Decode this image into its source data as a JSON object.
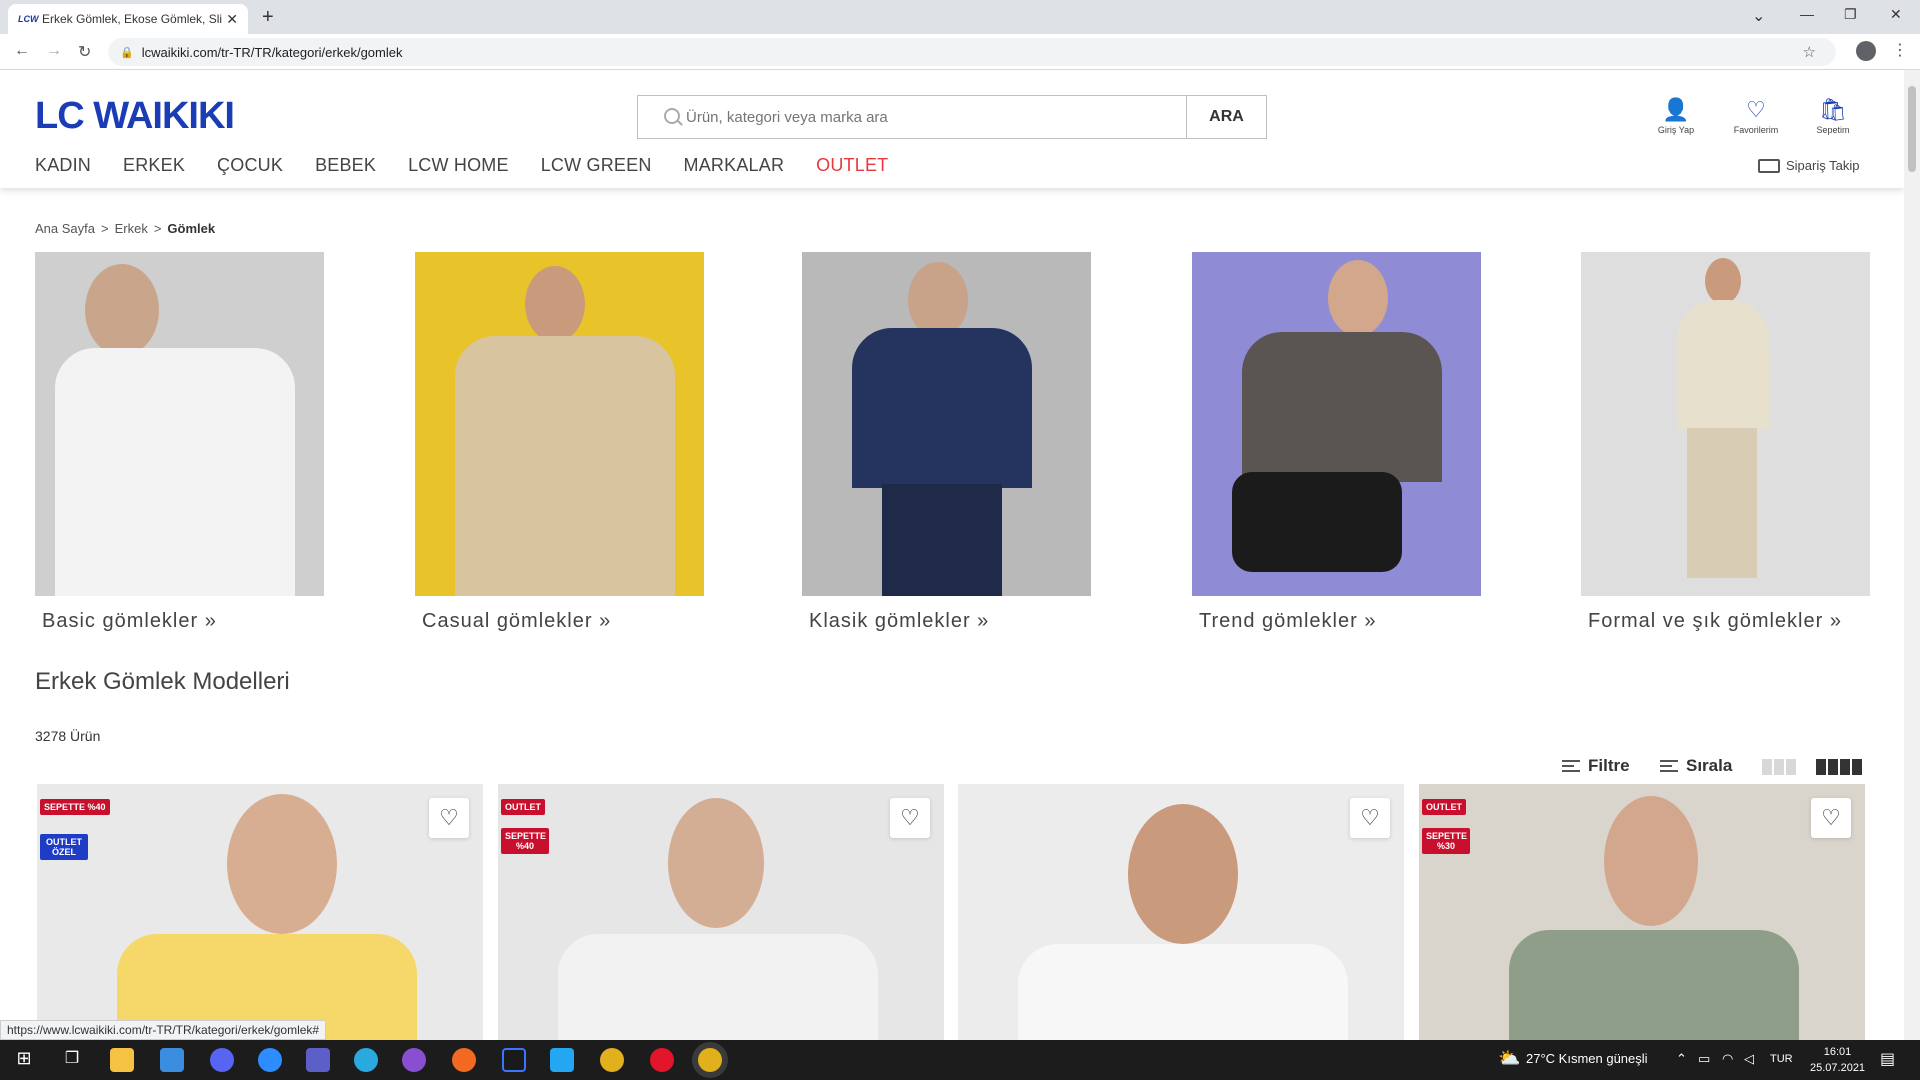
{
  "browser": {
    "tab_title": "Erkek Gömlek, Ekose Gömlek, Slim",
    "favicon_text": "LCW",
    "url": "lcwaikiki.com/tr-TR/TR/kategori/erkek/gomlek",
    "status_url": "https://www.lcwaikiki.com/tr-TR/TR/kategori/erkek/gomlek#"
  },
  "header": {
    "logo": "LC WAIKIKI",
    "search_placeholder": "Ürün, kategori veya marka ara",
    "search_button": "ARA",
    "actions": [
      {
        "label": "Giriş Yap",
        "icon": "user-icon"
      },
      {
        "label": "Favorilerim",
        "icon": "heart-icon"
      },
      {
        "label": "Sepetim",
        "icon": "bag-icon"
      }
    ],
    "nav": [
      "KADIN",
      "ERKEK",
      "ÇOCUK",
      "BEBEK",
      "LCW HOME",
      "LCW GREEN",
      "MARKALAR",
      "OUTLET"
    ],
    "order_track": "Sipariş Takip"
  },
  "breadcrumb": [
    "Ana Sayfa",
    "Erkek",
    "Gömlek"
  ],
  "categories": [
    {
      "label": "Basic gömlekler »",
      "bg": "#cfcfcf"
    },
    {
      "label": "Casual gömlekler »",
      "bg": "#e8c42a"
    },
    {
      "label": "Klasik gömlekler »",
      "bg": "#b9b9b9"
    },
    {
      "label": "Trend gömlekler »",
      "bg": "#8f8bd4"
    },
    {
      "label": "Formal ve şık gömlekler »",
      "bg": "#dedede"
    }
  ],
  "listing": {
    "title": "Erkek Gömlek Modelleri",
    "count": "3278 Ürün",
    "filter": "Filtre",
    "sort": "Sırala"
  },
  "products": [
    {
      "badges": [
        {
          "text": "SEPETTE %40",
          "color": "red"
        },
        {
          "text": "OUTLET ÖZEL",
          "color": "blue"
        }
      ],
      "bg": "#e9e9e9",
      "shirt": "#f6d86a"
    },
    {
      "badges": [
        {
          "text": "OUTLET",
          "color": "red"
        },
        {
          "text": "SEPETTE %40",
          "color": "red"
        }
      ],
      "bg": "#e6e6e6",
      "shirt": "#f2f2f2"
    },
    {
      "badges": [],
      "bg": "#ececec",
      "shirt": "#f7f7f7"
    },
    {
      "badges": [
        {
          "text": "OUTLET",
          "color": "red"
        },
        {
          "text": "SEPETTE %30",
          "color": "red"
        }
      ],
      "bg": "#d9d4cc",
      "shirt": "#8f9e88"
    }
  ],
  "taskbar": {
    "weather": "27°C  Kısmen güneşli",
    "lang": "TUR",
    "time": "16:01",
    "date": "25.07.2021"
  },
  "colors": {
    "brand": "#1a3db5",
    "outlet": "#e8383d"
  }
}
